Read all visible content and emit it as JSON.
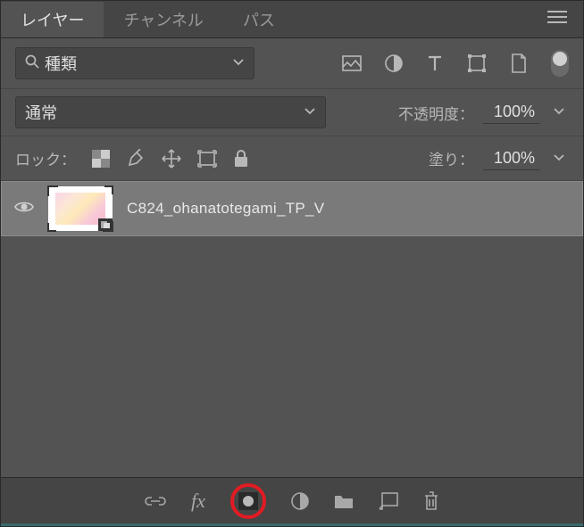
{
  "tabs": {
    "layers": "レイヤー",
    "channels": "チャンネル",
    "paths": "パス"
  },
  "filter": {
    "search_label": "種類"
  },
  "blend": {
    "mode": "通常",
    "opacity_label": "不透明度：",
    "opacity_value": "100%"
  },
  "lock": {
    "label": "ロック：",
    "fill_label": "塗り：",
    "fill_value": "100%"
  },
  "layers": [
    {
      "name": "C824_ohanatotegami_TP_V",
      "visible": true
    }
  ]
}
